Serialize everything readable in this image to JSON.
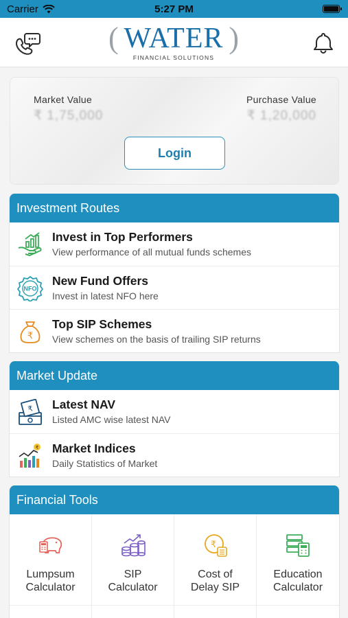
{
  "status_bar": {
    "carrier": "Carrier",
    "time": "5:27 PM",
    "icons": [
      "wifi-icon",
      "battery-icon"
    ]
  },
  "header": {
    "logo": {
      "word": "WATER",
      "subtitle": "FINANCIAL SOLUTIONS"
    },
    "left_icon": "chat-phone-icon",
    "right_icon": "bell-icon"
  },
  "portfolio_card": {
    "market_value_label": "Market Value",
    "market_value": "₹ 1,75,000",
    "purchase_value_label": "Purchase Value",
    "purchase_value": "₹ 1,20,000",
    "login_label": "Login"
  },
  "investment_routes": {
    "title": "Investment Routes",
    "items": [
      {
        "title": "Invest in Top Performers",
        "desc": "View performance of all mutual funds schemes",
        "icon": "growth-hand-icon"
      },
      {
        "title": "New Fund Offers",
        "desc": "Invest in latest NFO here",
        "icon": "nfo-badge-icon"
      },
      {
        "title": "Top SIP Schemes",
        "desc": "View schemes on the basis of trailing SIP returns",
        "icon": "rupee-bag-icon"
      }
    ]
  },
  "market_update": {
    "title": "Market Update",
    "items": [
      {
        "title": "Latest NAV",
        "desc": "Listed AMC wise latest NAV",
        "icon": "cash-stack-icon"
      },
      {
        "title": "Market Indices",
        "desc": "Daily Statistics of Market",
        "icon": "market-chart-icon"
      }
    ]
  },
  "financial_tools": {
    "title": "Financial Tools",
    "items": [
      {
        "name": "Lumpsum\nCalculator",
        "icon": "piggy-calculator-icon"
      },
      {
        "name": "SIP\nCalculator",
        "icon": "coins-growth-icon"
      },
      {
        "name": "Cost of\nDelay SIP",
        "icon": "rupee-clock-icon"
      },
      {
        "name": "Education\nCalculator",
        "icon": "books-calculator-icon"
      }
    ]
  },
  "colors": {
    "accent": "#1f8fbf",
    "logo_blue": "#1a6fa8",
    "login_text": "#1d7fb0",
    "icon_green": "#3fae5a",
    "icon_teal": "#2a9fb3",
    "icon_orange": "#e58a1f",
    "icon_red": "#e3655b",
    "icon_purple": "#7b5fc4"
  }
}
